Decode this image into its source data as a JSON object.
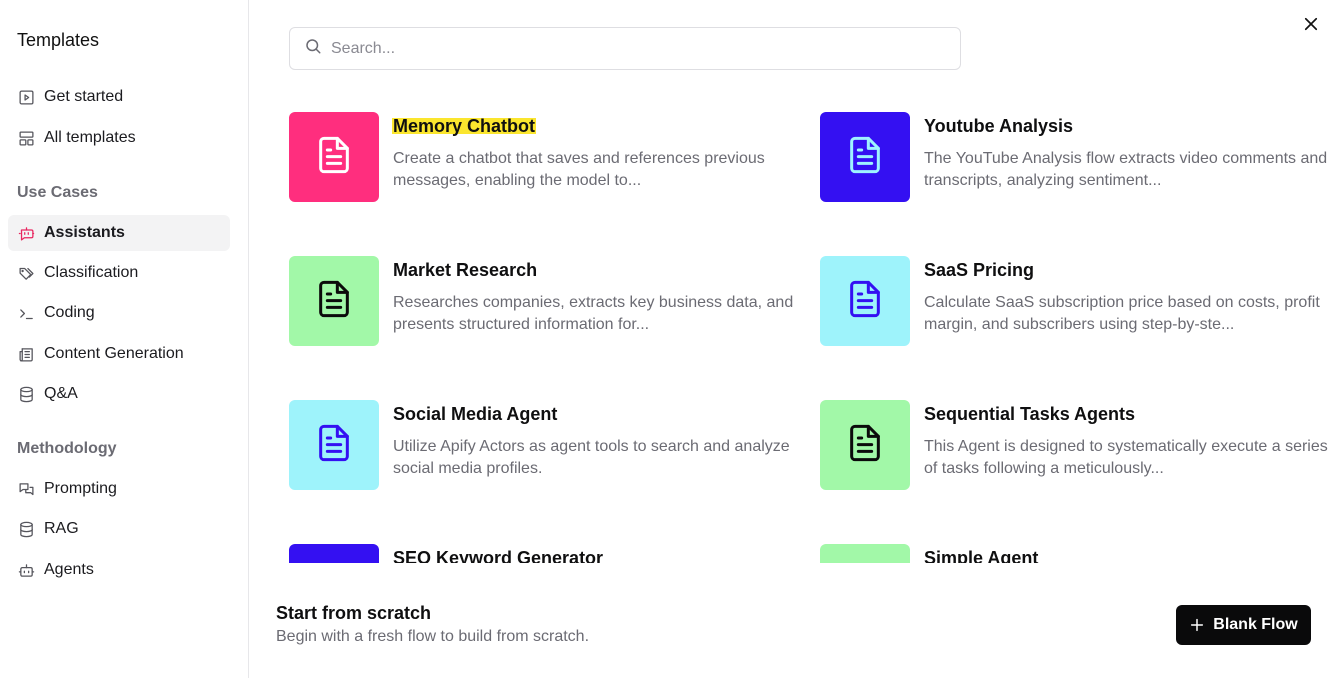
{
  "sidebar": {
    "title": "Templates",
    "top_items": [
      {
        "label": "Get started",
        "icon": "play-square-icon"
      },
      {
        "label": "All templates",
        "icon": "layout-grid-icon"
      }
    ],
    "use_cases_heading": "Use Cases",
    "use_cases": [
      {
        "label": "Assistants",
        "icon": "bot-message-icon",
        "active": true
      },
      {
        "label": "Classification",
        "icon": "tags-icon"
      },
      {
        "label": "Coding",
        "icon": "terminal-icon"
      },
      {
        "label": "Content Generation",
        "icon": "newspaper-icon"
      },
      {
        "label": "Q&A",
        "icon": "database-icon"
      }
    ],
    "methodology_heading": "Methodology",
    "methodology": [
      {
        "label": "Prompting",
        "icon": "messages-icon"
      },
      {
        "label": "RAG",
        "icon": "database-icon"
      },
      {
        "label": "Agents",
        "icon": "bot-icon"
      }
    ]
  },
  "search": {
    "placeholder": "Search..."
  },
  "templates": [
    {
      "title": "Memory Chatbot",
      "desc": "Create a chatbot that saves and references previous messages, enabling the model to...",
      "bg": "#ff2e7e",
      "fg": "#ffffff",
      "highlighted": true
    },
    {
      "title": "Youtube Analysis",
      "desc": "The YouTube Analysis flow extracts video comments and transcripts, analyzing sentiment...",
      "bg": "#3410f2",
      "fg": "#9ef3ff"
    },
    {
      "title": "Market Research",
      "desc": "Researches companies, extracts key business data, and presents structured information for...",
      "bg": "#a2f8a8",
      "fg": "#0b0b0b"
    },
    {
      "title": "SaaS Pricing",
      "desc": "Calculate SaaS subscription price based on costs, profit margin, and subscribers using step-by-ste...",
      "bg": "#9ef3fb",
      "fg": "#3410f2"
    },
    {
      "title": "Social Media Agent",
      "desc": "Utilize Apify Actors as agent tools to search and analyze social media profiles.",
      "bg": "#9ef3fb",
      "fg": "#3410f2"
    },
    {
      "title": "Sequential Tasks Agents",
      "desc": "This Agent is designed to systematically execute a series of tasks following a meticulously...",
      "bg": "#a2f8a8",
      "fg": "#0b0b0b"
    },
    {
      "title": "SEO Keyword Generator",
      "desc": "",
      "bg": "#3410f2",
      "fg": "#9ef3ff"
    },
    {
      "title": "Simple Agent",
      "desc": "",
      "bg": "#a2f8a8",
      "fg": "#0b0b0b"
    }
  ],
  "footer": {
    "title": "Start from scratch",
    "subtitle": "Begin with a fresh flow to build from scratch.",
    "button_label": "Blank Flow"
  }
}
